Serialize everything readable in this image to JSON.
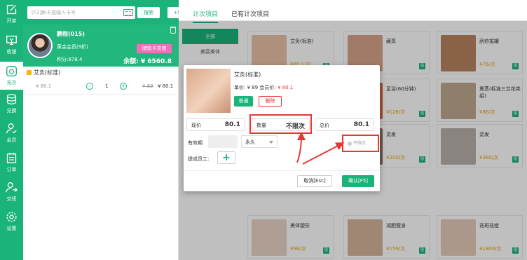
{
  "nav": [
    {
      "label": "开单",
      "icon": "edit-icon"
    },
    {
      "label": "收银",
      "icon": "cashier-icon"
    },
    {
      "label": "充次",
      "icon": "recharge-icon"
    },
    {
      "label": "兑换",
      "icon": "exchange-icon"
    },
    {
      "label": "会员",
      "icon": "member-icon"
    },
    {
      "label": "订单",
      "icon": "order-icon"
    },
    {
      "label": "交班",
      "icon": "handover-icon"
    },
    {
      "label": "设置",
      "icon": "settings-icon"
    }
  ],
  "left": {
    "search_placeholder": "[F2]刷卡或输入卡号",
    "search_button": "搜索",
    "add_button": "+新增",
    "member": {
      "name": "鹏程(015)",
      "level": "黄金会员(9折)",
      "points": "积分:878.4",
      "charge_button": "储值卡充值",
      "balance": "余额: ¥ 6560.8"
    },
    "cart": {
      "name": "艾灸(标准)",
      "price": "¥ 80.1",
      "minus": "-",
      "qty": "1",
      "plus": "+",
      "old_price": "¥ 89",
      "new_price": "¥ 80.1"
    }
  },
  "tabs": [
    "计次项目",
    "已有计次项目"
  ],
  "categories": [
    "全部",
    "美容美体"
  ],
  "products": [
    {
      "name": "艾灸(标准)",
      "price": "¥80.1/次",
      "tone": "#e9c2a6"
    },
    {
      "name": "藏蒸",
      "price": "",
      "tone": "#d8a58b"
    },
    {
      "name": "刮痧拔罐",
      "price": "¥76/次",
      "tone": "#b9835f"
    },
    {
      "name": "足浴(90分钟)",
      "price": "¥168/次",
      "tone": "#c97b53"
    },
    {
      "name": "足浴(60分钟)",
      "price": "¥128/次",
      "tone": "#d46a45"
    },
    {
      "name": "熏蒸(标准三艾花类组)",
      "price": "¥86/次",
      "tone": "#bfa98f"
    },
    {
      "name": "手足护理",
      "price": "¥128/次",
      "tone": "#e2c3b8"
    },
    {
      "name": "烫发",
      "price": "¥200/次",
      "tone": "#8c7361"
    },
    {
      "name": "烫发",
      "price": "¥360/次",
      "tone": "#b9b1ab"
    },
    {
      "name": "美体塑形",
      "price": "¥98/次",
      "tone": "#e8d3c4"
    },
    {
      "name": "减肥瘦身",
      "price": "¥159/次",
      "tone": "#d4b49b"
    },
    {
      "name": "祛斑祛痘",
      "price": "¥1800/次",
      "tone": "#e5cbb8"
    }
  ],
  "product_badge": "图",
  "dialog": {
    "name": "艾灸(标准)",
    "unit_price": "单价: ¥ 89",
    "member_price_label": "会员价:",
    "member_price": "¥ 80.1",
    "plain_button": "普通",
    "delete_button": "删除",
    "current_label": "现价",
    "current_value": "80.1",
    "qty_label": "数量",
    "qty_value": "不限次",
    "total_label": "总价",
    "total_value": "80.1",
    "validity_label": "有效期",
    "validity_value": "永久",
    "unlimited_check": "不限次",
    "staff_label": "提成员工:",
    "add_staff": "+",
    "cancel_button": "取消[Esc]",
    "confirm_button": "确认[F5]"
  },
  "colors": {
    "brand": "#1ab37a",
    "accent_pink": "#ee6fbc",
    "highlight_red": "#e53935"
  }
}
